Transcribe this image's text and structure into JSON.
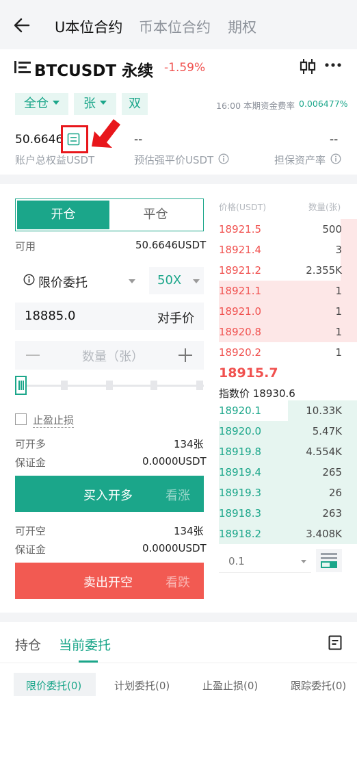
{
  "nav": {
    "tabs": [
      {
        "label": "U本位合约",
        "active": true
      },
      {
        "label": "币本位合约",
        "active": false
      },
      {
        "label": "期权",
        "active": false
      }
    ]
  },
  "header": {
    "symbol": "BTCUSDT 永续",
    "change": "-1.59%",
    "margin_mode": "全仓",
    "unit": "张",
    "position_mode": "双",
    "funding_label": "16:00 本期资金费率",
    "funding_rate": "0.006477%"
  },
  "account": {
    "equity_value": "50.6646",
    "equity_label": "账户总权益USDT",
    "liq_value": "--",
    "liq_label": "预估强平价USDT",
    "ratio_value": "--",
    "ratio_label": "担保资产率"
  },
  "order": {
    "tab_open": "开仓",
    "tab_close": "平仓",
    "available_label": "可用",
    "available_value": "50.6646USDT",
    "order_type": "限价委托",
    "leverage": "50X",
    "price": "18885.0",
    "counterparty": "对手价",
    "qty_placeholder": "数量（张）",
    "slider_percent": 0,
    "tpsl_label": "止盈止损",
    "long_label": "可开多",
    "long_value": "134张",
    "margin_label_1": "保证金",
    "margin_value_1": "0.0000USDT",
    "buy_button": "买入开多",
    "buy_hint": "看涨",
    "short_label": "可开空",
    "short_value": "134张",
    "margin_label_2": "保证金",
    "margin_value_2": "0.0000USDT",
    "sell_button": "卖出开空",
    "sell_hint": "看跌"
  },
  "orderbook": {
    "price_header": "价格(USDT)",
    "qty_header": "数量(张)",
    "asks": [
      {
        "price": "18921.5",
        "qty": "500",
        "depth": 0.12
      },
      {
        "price": "18921.4",
        "qty": "3",
        "depth": 0.12
      },
      {
        "price": "18921.2",
        "qty": "2.355K",
        "depth": 0.12
      },
      {
        "price": "18921.1",
        "qty": "1",
        "depth": 1.0
      },
      {
        "price": "18921.0",
        "qty": "1",
        "depth": 1.0
      },
      {
        "price": "18920.8",
        "qty": "1",
        "depth": 1.0
      },
      {
        "price": "18920.2",
        "qty": "1",
        "depth": 0.0
      }
    ],
    "last_price": "18915.7",
    "index_label": "指数价 18930.6",
    "bids": [
      {
        "price": "18920.1",
        "qty": "10.33K",
        "depth": 0.5
      },
      {
        "price": "18920.0",
        "qty": "5.47K",
        "depth": 1.0
      },
      {
        "price": "18919.8",
        "qty": "4.554K",
        "depth": 1.0
      },
      {
        "price": "18919.4",
        "qty": "265",
        "depth": 1.0
      },
      {
        "price": "18919.3",
        "qty": "26",
        "depth": 1.0
      },
      {
        "price": "18918.3",
        "qty": "263",
        "depth": 1.0
      },
      {
        "price": "18918.2",
        "qty": "3.408K",
        "depth": 1.0
      }
    ],
    "precision": "0.1"
  },
  "bottom": {
    "tab_positions": "持仓",
    "tab_orders": "当前委托",
    "sub_limit": "限价委托(0)",
    "sub_plan": "计划委托(0)",
    "sub_tpsl": "止盈止损(0)",
    "sub_trail": "跟踪委托(0)"
  },
  "colors": {
    "accent": "#1ba68a",
    "sell": "#f0514f",
    "highlight": "#e8161b"
  }
}
